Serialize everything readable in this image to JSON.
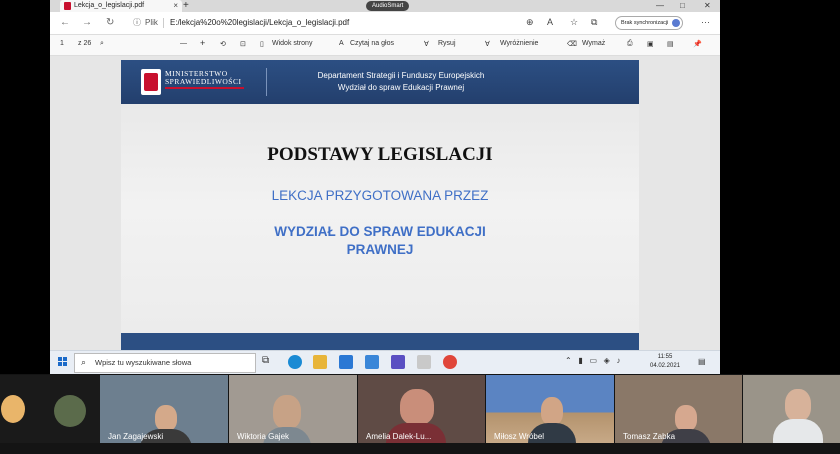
{
  "browser": {
    "tab_title": "Lekcja_o_legislacji.pdf",
    "tab_close": "×",
    "new_tab": "+",
    "audiosmart": "AudioSmart",
    "win_min": "—",
    "win_max": "□",
    "win_close": "✕",
    "back": "←",
    "forward": "→",
    "reload": "↻",
    "plik": "Plik",
    "url": "E:/lekcja%20o%20legislacji/Lekcja_o_legislacji.pdf",
    "sync_label": "Brak synchronizacji",
    "more": "···"
  },
  "pdf_toolbar": {
    "page": "1",
    "of_pages": "z 26",
    "zoom_out": "—",
    "zoom_in": "+",
    "view": "Widok strony",
    "read_aloud": "Czytaj na głos",
    "draw": "Rysuj",
    "highlight": "Wyróżnienie",
    "erase": "Wymaż"
  },
  "slide": {
    "ministry_line1": "MINISTERSTWO",
    "ministry_line2": "SPRAWIEDLIWOŚCI",
    "department_line1": "Departament Strategii i Funduszy Europejskich",
    "department_line2": "Wydział do spraw Edukacji Prawnej",
    "title": "PODSTAWY LEGISLACJI",
    "subtitle1": "LEKCJA PRZYGOTOWANA PRZEZ",
    "subtitle2_line1": "WYDZIAŁ DO SPRAW EDUKACJI",
    "subtitle2_line2": "PRAWNEJ"
  },
  "taskbar": {
    "search_placeholder": "Wpisz tu wyszukiwane słowa",
    "time": "11:55",
    "date": "04.02.2021"
  },
  "participants": [
    {
      "name": ""
    },
    {
      "name": ""
    },
    {
      "name": "Jan Zagajewski"
    },
    {
      "name": "Wiktoria Gajek"
    },
    {
      "name": "Amelia Dalek-Lu..."
    },
    {
      "name": "Miłosz Wróbel"
    },
    {
      "name": "Tomasz Zabka"
    },
    {
      "name": ""
    }
  ],
  "colors": {
    "slide_header": "#2c4f83",
    "slide_accent_text": "#3f6fc6",
    "ministry_red": "#c8102e"
  }
}
